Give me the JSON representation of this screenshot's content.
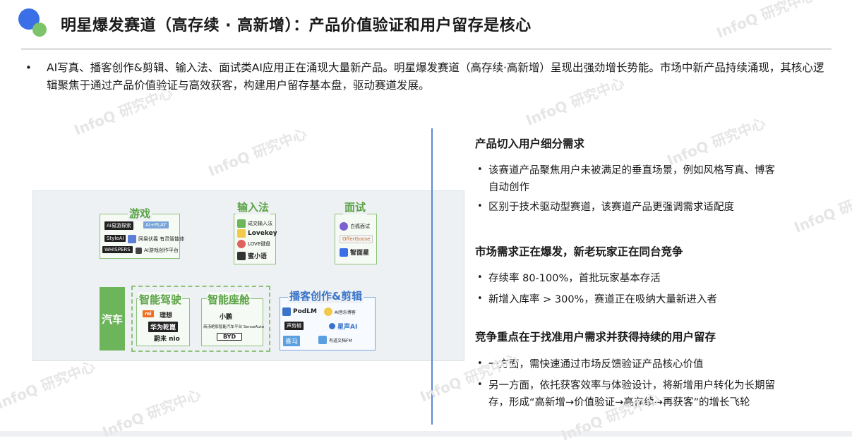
{
  "title": "明星爆发赛道（高存续 · 高新增）：产品价值验证和用户留存是核心",
  "intro_bullet": "•",
  "intro": "AI写真、播客创作&剪辑、输入法、面试类AI应用正在涌现大量新产品。明星爆发赛道（高存续·高新增）呈现出强劲增长势能。市场中新产品持续涌现，其核心逻辑聚焦于通过产品价值验证与高效获客，构建用户留存基本盘，驱动赛道发展。",
  "diagram": {
    "games": {
      "label": "游戏",
      "logos": [
        "AI易游探索",
        "AI+PLAY",
        "StyleAI",
        "网易伏羲 有灵智能体",
        "WHISPERS",
        "AI游戏创作平台"
      ]
    },
    "ime": {
      "label": "输入法",
      "logos": [
        "成交输入法",
        "Lovekey",
        "LOVE键盘",
        "蜜小语"
      ]
    },
    "interview": {
      "label": "面试",
      "logos": [
        "白狐面试",
        "OfferGoose",
        "智面星"
      ]
    },
    "car": {
      "label": "汽车"
    },
    "driving": {
      "label": "智能驾驶",
      "logos": [
        "mi",
        "理想",
        "华为乾崑",
        "蔚来 nio"
      ]
    },
    "cockpit": {
      "label": "智能座舱",
      "logos": [
        "小鹏",
        "商汤绝影智能汽车平台 SenseAuto",
        "BYD"
      ]
    },
    "podcast": {
      "label": "播客创作&剪辑",
      "logos": [
        "PodLM",
        "AI音乐博客",
        "声剪辑",
        "星声AI",
        "喜马",
        "有道文档FM"
      ]
    }
  },
  "sections": [
    {
      "heading": "产品切入用户细分需求",
      "bullets": [
        "该赛道产品聚焦用户未被满足的垂直场景，例如风格写真、博客自动创作",
        "区别于技术驱动型赛道，该赛道产品更强调需求适配度"
      ]
    },
    {
      "heading": "市场需求正在爆发，新老玩家正在同台竞争",
      "bullets": [
        "存续率 80-100%，首批玩家基本存活",
        "新增入库率 > 300%，赛道正在吸纳大量新进入者"
      ]
    },
    {
      "heading": "竞争重点在于找准用户需求并获得持续的用户留存",
      "bullets": [
        "一方面，需快速通过市场反馈验证产品核心价值",
        "另一方面，依托获客效率与体验设计，将新增用户转化为长期留存，形成“高新增→价值验证→高存续→再获客”的增长飞轮"
      ]
    }
  ],
  "bullet_glyph": "•",
  "watermark": "InfoQ 研究中心",
  "colors": {
    "accent_blue": "#3a6fe8",
    "accent_green": "#6db55a",
    "divider_blue": "#5b87d6"
  }
}
